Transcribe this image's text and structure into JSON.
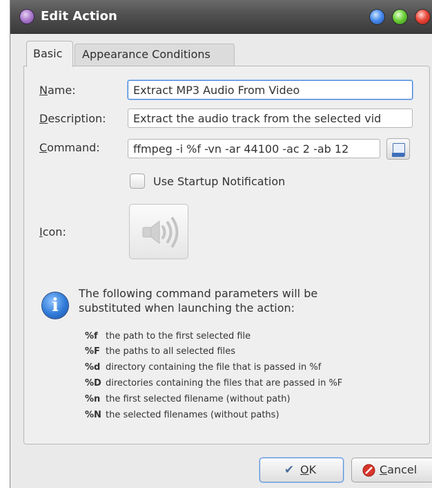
{
  "window": {
    "title": "Edit Action",
    "controls": [
      "minimize",
      "maximize",
      "close"
    ]
  },
  "tabs": [
    {
      "label": "Basic",
      "active": true
    },
    {
      "label": "Appearance Conditions",
      "active": false
    }
  ],
  "form": {
    "name": {
      "mnemonic": "N",
      "rest": "ame:",
      "value": "Extract MP3 Audio From Video"
    },
    "description": {
      "mnemonic": "D",
      "rest": "escription:",
      "value": "Extract the audio track from the selected vid"
    },
    "command": {
      "mnemonic": "C",
      "rest": "ommand:",
      "value": "ffmpeg -i %f -vn -ar 44100 -ac 2 -ab 12"
    },
    "startup_notification": {
      "label": "Use Startup Notification",
      "checked": false
    },
    "icon": {
      "mnemonic": "I",
      "rest": "con:",
      "icon_name": "speaker-icon"
    }
  },
  "info": {
    "line1": "The following command parameters will be",
    "line2": "substituted when launching the action:",
    "params": [
      {
        "code": "%f",
        "desc": "the path to the first selected file"
      },
      {
        "code": "%F",
        "desc": "the paths to all selected files"
      },
      {
        "code": "%d",
        "desc": "directory containing the file that is passed in %f"
      },
      {
        "code": "%D",
        "desc": "directories containing the files that are passed in %F"
      },
      {
        "code": "%n",
        "desc": "the first selected filename (without path)"
      },
      {
        "code": "%N",
        "desc": "the selected filenames (without paths)"
      }
    ]
  },
  "buttons": {
    "ok": {
      "mnemonic": "O",
      "rest": "K"
    },
    "cancel": {
      "mnemonic": "C",
      "rest": "ancel"
    }
  }
}
